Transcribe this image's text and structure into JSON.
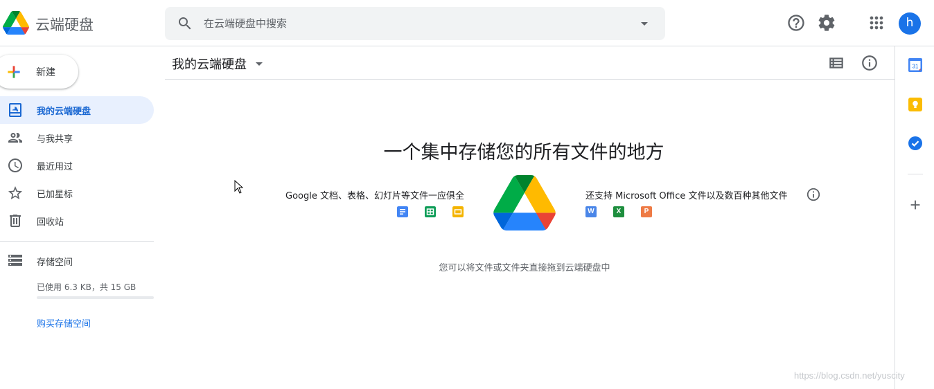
{
  "header": {
    "app_title": "云端硬盘",
    "search_placeholder": "在云端硬盘中搜索",
    "avatar_initial": "h"
  },
  "sidebar": {
    "new_label": "新建",
    "items": [
      {
        "label": "我的云端硬盘",
        "icon": "my-drive-icon",
        "active": true
      },
      {
        "label": "与我共享",
        "icon": "people-icon"
      },
      {
        "label": "最近用过",
        "icon": "clock-icon"
      },
      {
        "label": "已加星标",
        "icon": "star-icon"
      },
      {
        "label": "回收站",
        "icon": "trash-icon"
      }
    ],
    "storage": {
      "label": "存储空间",
      "used_text": "已使用 6.3 KB，共 15 GB",
      "used_fraction": 4e-07,
      "buy_label": "购买存储空间"
    }
  },
  "main": {
    "breadcrumb": "我的云端硬盘",
    "empty_state": {
      "title": "一个集中存储您的所有文件的地方",
      "google_text": "Google 文档、表格、幻灯片等文件一应俱全",
      "office_text": "还支持 Microsoft Office 文件以及数百种其他文件",
      "drop_hint": "您可以将文件或文件夹直接拖到云端硬盘中",
      "google_file_icons": [
        "docs-icon",
        "sheets-icon",
        "slides-icon"
      ],
      "office_file_icons": [
        {
          "icon": "word-icon",
          "letter": "W"
        },
        {
          "icon": "excel-icon",
          "letter": "X"
        },
        {
          "icon": "powerpoint-icon",
          "letter": "P"
        }
      ]
    }
  },
  "side_panel": {
    "calendar_day": "31",
    "apps": [
      "calendar-icon",
      "keep-icon",
      "tasks-icon"
    ]
  },
  "watermark": "https://blog.csdn.net/yuscity",
  "colors": {
    "accent": "#1a73e8",
    "active_bg": "#e8f0fe",
    "docs": "#4285f4",
    "sheets": "#0f9d58",
    "slides": "#f4b400",
    "word": "#4a86e8",
    "excel": "#1e8e3e",
    "powerpoint": "#ee7b45"
  }
}
